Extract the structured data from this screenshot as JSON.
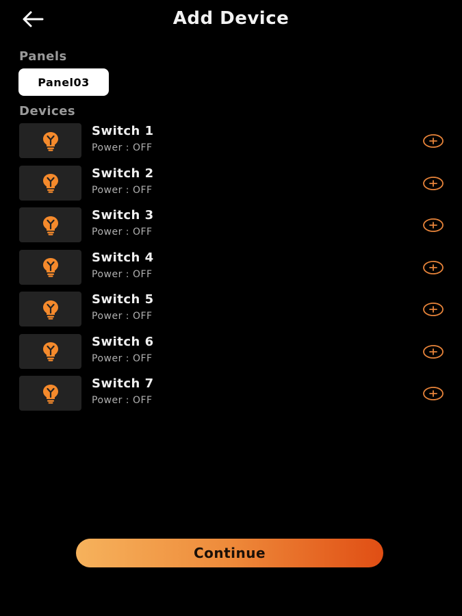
{
  "header": {
    "title": "Add Device",
    "back_icon": "arrow-left-icon"
  },
  "panels": {
    "label": "Panels",
    "items": [
      {
        "label": "Panel03"
      }
    ]
  },
  "devices": {
    "label": "Devices",
    "icon": "bulb-icon",
    "add_icon": "plus-circle-icon",
    "items": [
      {
        "name": "Switch 1",
        "status": "Power : OFF"
      },
      {
        "name": "Switch 2",
        "status": "Power : OFF"
      },
      {
        "name": "Switch 3",
        "status": "Power : OFF"
      },
      {
        "name": "Switch 4",
        "status": "Power : OFF"
      },
      {
        "name": "Switch 5",
        "status": "Power : OFF"
      },
      {
        "name": "Switch 6",
        "status": "Power : OFF"
      },
      {
        "name": "Switch 7",
        "status": "Power : OFF"
      }
    ]
  },
  "footer": {
    "continue_label": "Continue"
  },
  "colors": {
    "background": "#000000",
    "accent": "#f07a2a",
    "tile": "#232323"
  }
}
